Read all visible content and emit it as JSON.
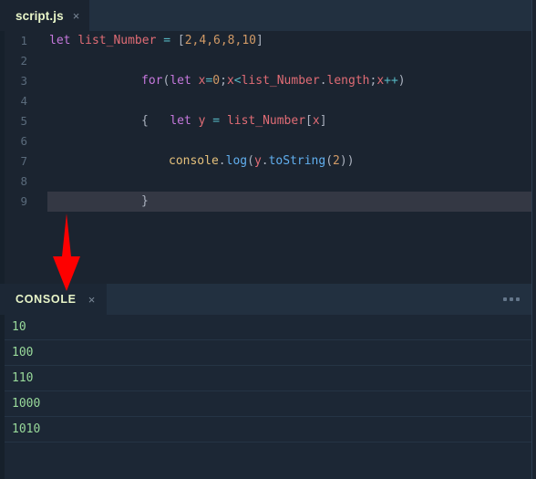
{
  "editor": {
    "tab": {
      "title": "script.js",
      "close_label": "×"
    },
    "lines": [
      {
        "number": "1",
        "indent": 0,
        "highlight": false,
        "tokens": [
          {
            "text": "let ",
            "cls": "t-kw"
          },
          {
            "text": "list_Number ",
            "cls": "t-var"
          },
          {
            "text": "= ",
            "cls": "t-op"
          },
          {
            "text": "[",
            "cls": "t-punct"
          },
          {
            "text": "2,4,6,8,10",
            "cls": "t-num"
          },
          {
            "text": "]",
            "cls": "t-punct"
          }
        ]
      },
      {
        "number": "2",
        "indent": 0,
        "highlight": false,
        "tokens": []
      },
      {
        "number": "3",
        "indent": 101,
        "highlight": false,
        "tokens": [
          {
            "text": "for",
            "cls": "t-kw"
          },
          {
            "text": "(",
            "cls": "t-punct"
          },
          {
            "text": "let ",
            "cls": "t-kw"
          },
          {
            "text": "x",
            "cls": "t-var"
          },
          {
            "text": "=",
            "cls": "t-op"
          },
          {
            "text": "0",
            "cls": "t-num"
          },
          {
            "text": ";",
            "cls": "t-punct"
          },
          {
            "text": "x",
            "cls": "t-var"
          },
          {
            "text": "<",
            "cls": "t-op"
          },
          {
            "text": "list_Number",
            "cls": "t-var"
          },
          {
            "text": ".",
            "cls": "t-punct"
          },
          {
            "text": "length",
            "cls": "t-var"
          },
          {
            "text": ";",
            "cls": "t-punct"
          },
          {
            "text": "x",
            "cls": "t-var"
          },
          {
            "text": "++",
            "cls": "t-op"
          },
          {
            "text": ")",
            "cls": "t-punct"
          }
        ]
      },
      {
        "number": "4",
        "indent": 0,
        "highlight": false,
        "tokens": []
      },
      {
        "number": "5",
        "indent": 101,
        "highlight": false,
        "tokens": [
          {
            "text": "{",
            "cls": "t-brace"
          },
          {
            "text": "   ",
            "cls": "t-punct"
          },
          {
            "text": "let ",
            "cls": "t-kw"
          },
          {
            "text": "y ",
            "cls": "t-var"
          },
          {
            "text": "= ",
            "cls": "t-op"
          },
          {
            "text": "list_Number",
            "cls": "t-var"
          },
          {
            "text": "[",
            "cls": "t-punct"
          },
          {
            "text": "x",
            "cls": "t-var"
          },
          {
            "text": "]",
            "cls": "t-punct"
          }
        ]
      },
      {
        "number": "6",
        "indent": 0,
        "highlight": false,
        "tokens": []
      },
      {
        "number": "7",
        "indent": 131,
        "highlight": false,
        "tokens": [
          {
            "text": "console",
            "cls": "t-obj"
          },
          {
            "text": ".",
            "cls": "t-punct"
          },
          {
            "text": "log",
            "cls": "t-fn"
          },
          {
            "text": "(",
            "cls": "t-punct"
          },
          {
            "text": "y",
            "cls": "t-var"
          },
          {
            "text": ".",
            "cls": "t-punct"
          },
          {
            "text": "toString",
            "cls": "t-fn"
          },
          {
            "text": "(",
            "cls": "t-punct"
          },
          {
            "text": "2",
            "cls": "t-num"
          },
          {
            "text": "))",
            "cls": "t-punct"
          }
        ]
      },
      {
        "number": "8",
        "indent": 0,
        "highlight": false,
        "tokens": []
      },
      {
        "number": "9",
        "indent": 101,
        "highlight": true,
        "tokens": [
          {
            "text": "}",
            "cls": "t-brace"
          }
        ]
      }
    ]
  },
  "annotation": {
    "arrow_color": "#fe0000",
    "arrow_direction": "down"
  },
  "console": {
    "tab": {
      "title": "CONSOLE",
      "close_label": "×"
    },
    "menu_label": "more-options",
    "rows": [
      "10",
      "100",
      "110",
      "1000",
      "1010"
    ]
  },
  "colors": {
    "editor_bg": "#1b2430",
    "tabbar_bg": "#223040",
    "console_bg": "#1c2735",
    "selection_bg": "#343844",
    "console_text": "#98d99a",
    "tab_title": "#e8f5c8"
  }
}
